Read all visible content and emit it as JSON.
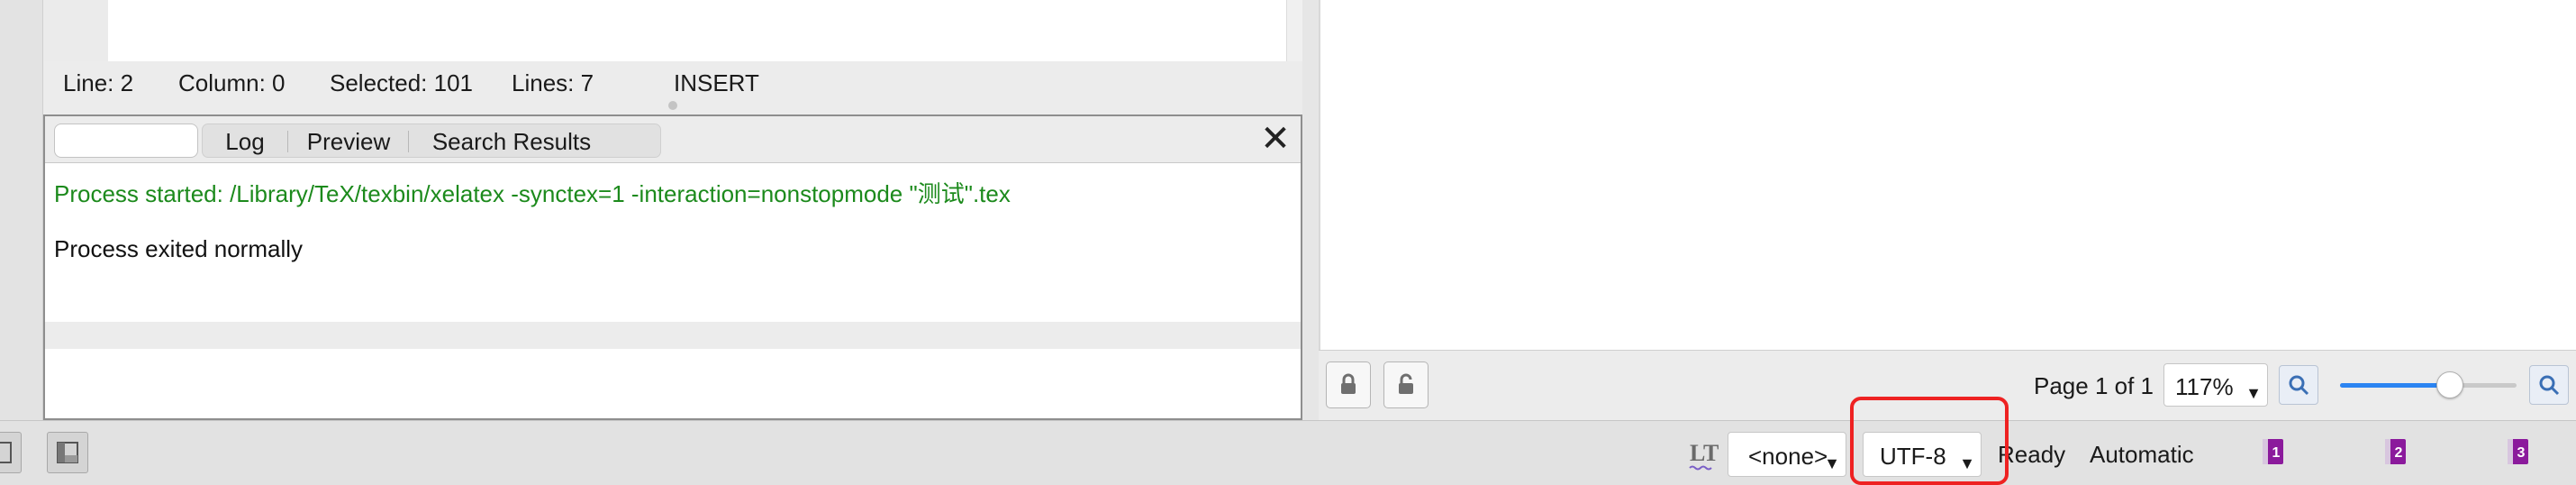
{
  "editor": {
    "status": {
      "line": "Line: 2",
      "column": "Column: 0",
      "selected": "Selected: 101",
      "lines": "Lines: 7",
      "mode": "INSERT"
    }
  },
  "messages": {
    "search_placeholder": "",
    "tabs": [
      {
        "label": "Log"
      },
      {
        "label": "Preview"
      },
      {
        "label": "Search Results"
      }
    ],
    "close_icon": "close-icon",
    "log_lines": [
      "Process started: /Library/TeX/texbin/xelatex -synctex=1 -interaction=nonstopmode \"测试\".tex",
      "Process exited normally"
    ]
  },
  "preview": {
    "page_label": "Page 1 of 1",
    "zoom": "117%",
    "zoom_slider_level": 0.62
  },
  "statusbar": {
    "language": "<none>",
    "encoding": "UTF-8",
    "state": "Ready",
    "compile_mode": "Automatic",
    "bookmarks": [
      "1",
      "2",
      "3"
    ]
  },
  "colors": {
    "log_green": "#1c8a1c",
    "highlight_red": "#ee2222",
    "slider_blue": "#2b84f2",
    "bookmark_purple": "#8b1a9c"
  }
}
